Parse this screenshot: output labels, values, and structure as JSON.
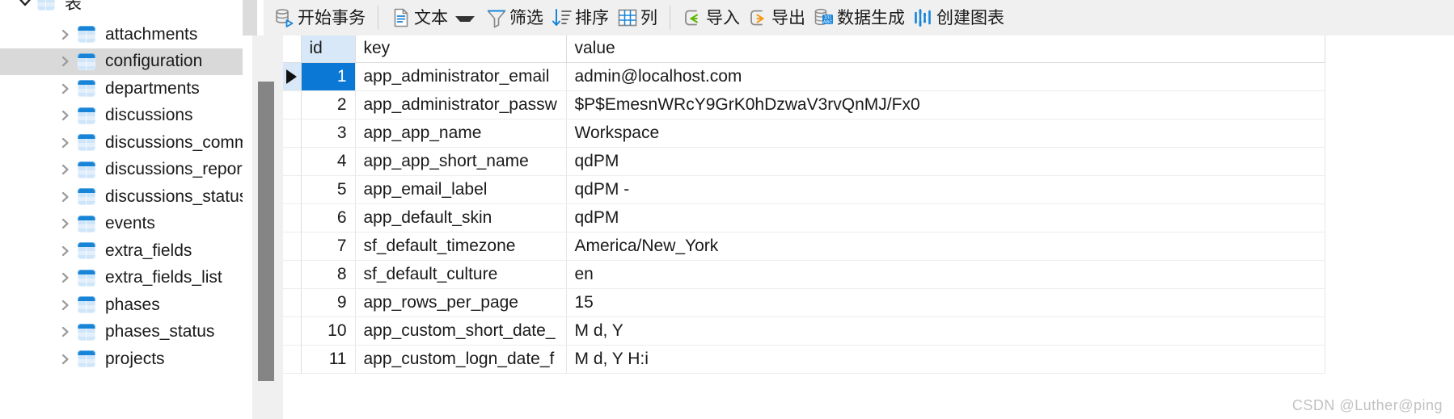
{
  "sidebar": {
    "root": {
      "label": "表",
      "expanded": true,
      "icon": "table-group-icon"
    },
    "selected_index": 1,
    "items": [
      {
        "label": "attachments",
        "icon": "table-icon"
      },
      {
        "label": "configuration",
        "icon": "table-icon"
      },
      {
        "label": "departments",
        "icon": "table-icon"
      },
      {
        "label": "discussions",
        "icon": "table-icon"
      },
      {
        "label": "discussions_comments",
        "icon": "table-icon"
      },
      {
        "label": "discussions_reports",
        "icon": "table-icon"
      },
      {
        "label": "discussions_statuses",
        "icon": "table-icon"
      },
      {
        "label": "events",
        "icon": "table-icon"
      },
      {
        "label": "extra_fields",
        "icon": "table-icon"
      },
      {
        "label": "extra_fields_list",
        "icon": "table-icon"
      },
      {
        "label": "phases",
        "icon": "table-icon"
      },
      {
        "label": "phases_status",
        "icon": "table-icon"
      },
      {
        "label": "projects",
        "icon": "table-icon"
      }
    ]
  },
  "toolbar": {
    "groups": [
      [
        {
          "id": "begin-transaction",
          "label": "开始事务",
          "icon": "database-play-icon",
          "caret": false
        }
      ],
      [
        {
          "id": "text-view",
          "label": "文本",
          "icon": "document-text-icon",
          "caret": true
        },
        {
          "id": "filter",
          "label": "筛选",
          "icon": "funnel-icon",
          "caret": false
        },
        {
          "id": "sort",
          "label": "排序",
          "icon": "sort-descending-icon",
          "caret": false
        },
        {
          "id": "columns",
          "label": "列",
          "icon": "grid-columns-icon",
          "caret": false
        }
      ],
      [
        {
          "id": "import",
          "label": "导入",
          "icon": "import-arrow-icon",
          "caret": false
        },
        {
          "id": "export",
          "label": "导出",
          "icon": "export-arrow-icon",
          "caret": false
        },
        {
          "id": "data-generation",
          "label": "数据生成",
          "icon": "database-101abc-icon",
          "caret": false
        },
        {
          "id": "create-chart",
          "label": "创建图表",
          "icon": "bar-chart-icon",
          "caret": false
        }
      ]
    ]
  },
  "grid": {
    "columns": [
      {
        "key": "id",
        "label": "id",
        "selected": true
      },
      {
        "key": "key",
        "label": "key",
        "selected": false
      },
      {
        "key": "value",
        "label": "value",
        "selected": false
      }
    ],
    "current_row_index": 0,
    "hover_row_index": 5,
    "rows": [
      {
        "id": "1",
        "key": "app_administrator_email",
        "value": "admin@localhost.com"
      },
      {
        "id": "2",
        "key": "app_administrator_passw",
        "value": "$P$EmesnWRcY9GrK0hDzwaV3rvQnMJ/Fx0"
      },
      {
        "id": "3",
        "key": "app_app_name",
        "value": "Workspace"
      },
      {
        "id": "4",
        "key": "app_app_short_name",
        "value": "qdPM"
      },
      {
        "id": "5",
        "key": "app_email_label",
        "value": "qdPM -"
      },
      {
        "id": "6",
        "key": "app_default_skin",
        "value": "qdPM"
      },
      {
        "id": "7",
        "key": "sf_default_timezone",
        "value": "America/New_York"
      },
      {
        "id": "8",
        "key": "sf_default_culture",
        "value": "en"
      },
      {
        "id": "9",
        "key": "app_rows_per_page",
        "value": "15"
      },
      {
        "id": "10",
        "key": "app_custom_short_date_",
        "value": "M d, Y"
      },
      {
        "id": "11",
        "key": "app_custom_logn_date_f",
        "value": "M d, Y H:i"
      }
    ]
  },
  "watermark": {
    "text": "CSDN @Luther@ping"
  },
  "colors": {
    "accent_blue": "#0a78d4",
    "selection_row": "#d9e8f8",
    "tree_selection": "#d9d9d9",
    "toolbar_bg": "#f0f0f0",
    "zebra": "#f8f8f8",
    "icon_blue": "#1884d8",
    "import_green": "#5cb800",
    "export_orange": "#f59a13"
  }
}
